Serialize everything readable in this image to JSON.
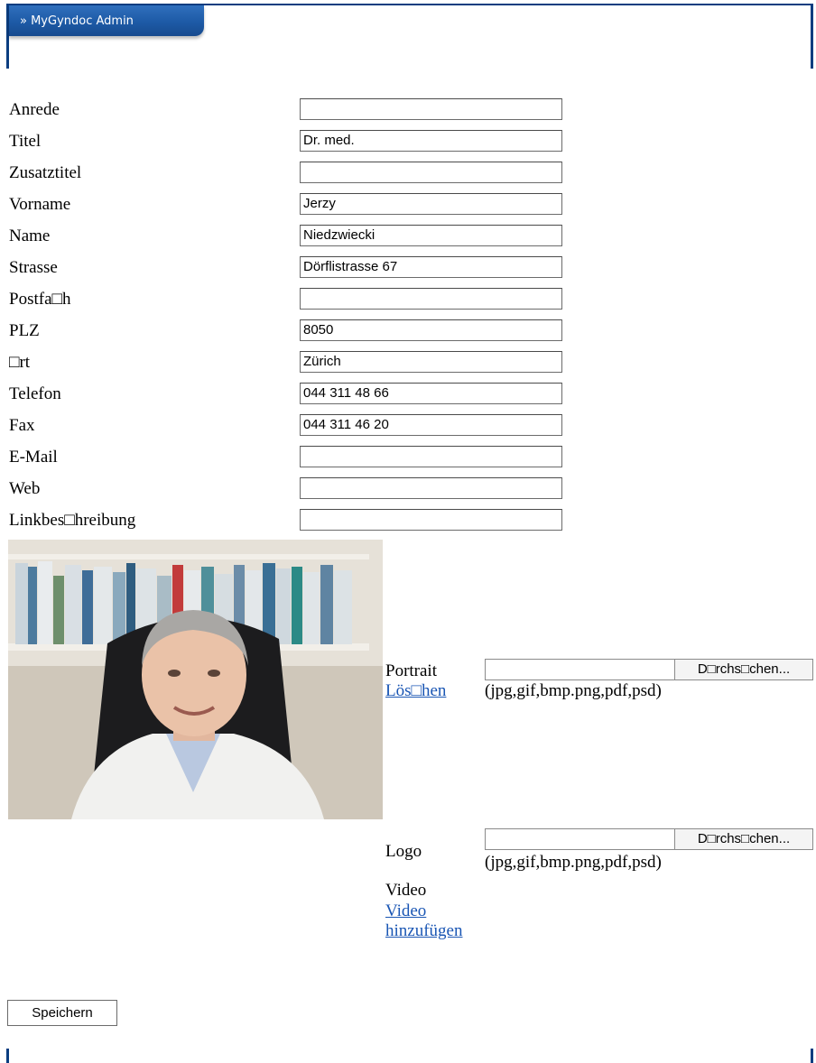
{
  "header": {
    "tab_label": "» MyGyndoc Admin"
  },
  "form": {
    "fields": [
      {
        "label": "Anrede",
        "value": ""
      },
      {
        "label": "Titel",
        "value": "Dr. med."
      },
      {
        "label": "Zusatztitel",
        "value": ""
      },
      {
        "label": "Vorname",
        "value": "Jerzy"
      },
      {
        "label": "Name",
        "value": "Niedzwiecki"
      },
      {
        "label": "Strasse",
        "value": "Dörflistrasse 67"
      },
      {
        "label": "Postfa□h",
        "value": ""
      },
      {
        "label": "PLZ",
        "value": "8050"
      },
      {
        "label": "□rt",
        "value": "Zürich"
      },
      {
        "label": "Telefon",
        "value": "044 311 48 66"
      },
      {
        "label": "Fax",
        "value": "044 311 46 20"
      },
      {
        "label": "E-Mail",
        "value": ""
      },
      {
        "label": "Web",
        "value": ""
      },
      {
        "label": "Linkbes□hreibung",
        "value": ""
      }
    ]
  },
  "portrait": {
    "label": "Portrait",
    "delete_link": "Lös□hen",
    "browse_label": "D□rchs□chen...",
    "formats": "(jpg,gif,bmp.png,pdf,psd)"
  },
  "logo": {
    "label": "Logo",
    "browse_label": "D□rchs□chen...",
    "formats": "(jpg,gif,bmp.png,pdf,psd)"
  },
  "video": {
    "label": "Video",
    "add_link": "Video hinzufügen"
  },
  "actions": {
    "save_label": "Speichern"
  },
  "colors": {
    "frame": "#0b3d80",
    "tab": "#1d5aa6",
    "link": "#1a56b4"
  }
}
